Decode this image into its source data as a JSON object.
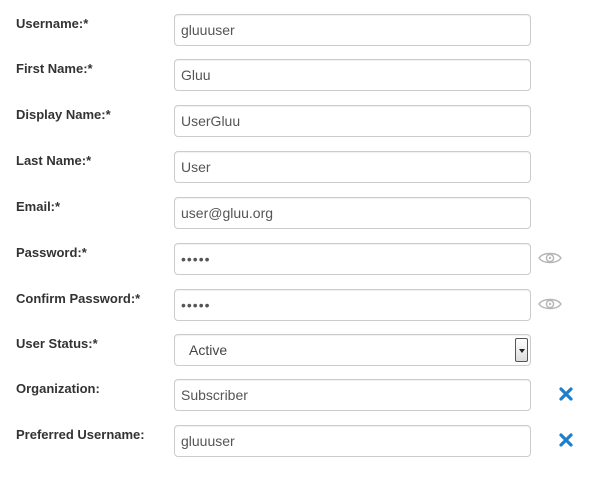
{
  "colors": {
    "accent": "#1f7ec9",
    "eye_icon": "#b5b5b5",
    "border": "#cccccc"
  },
  "fields": {
    "username": {
      "label": "Username:*",
      "value": "gluuuser"
    },
    "first_name": {
      "label": "First Name:*",
      "value": "Gluu"
    },
    "display_name": {
      "label": "Display Name:*",
      "value": "UserGluu"
    },
    "last_name": {
      "label": "Last Name:*",
      "value": "User"
    },
    "email": {
      "label": "Email:*",
      "value": "user@gluu.org"
    },
    "password": {
      "label": "Password:*",
      "value": "•••••",
      "icon": "eye-icon"
    },
    "confirm_password": {
      "label": "Confirm Password:*",
      "value": "•••••",
      "icon": "eye-icon"
    },
    "user_status": {
      "label": "User Status:*",
      "value": "Active",
      "icon": "chevron-down-icon"
    },
    "organization": {
      "label": "Organization:",
      "value": "Subscriber",
      "icon": "remove-icon"
    },
    "preferred_username": {
      "label": "Preferred Username:",
      "value": "gluuuser",
      "icon": "remove-icon"
    }
  }
}
